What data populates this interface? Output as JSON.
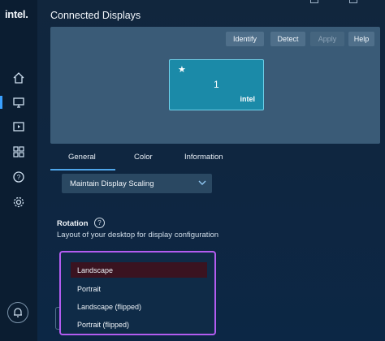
{
  "app": {
    "logo_text": "intel."
  },
  "page": {
    "title": "Connected Displays"
  },
  "sidebar": {
    "items": [
      {
        "icon": "home-icon"
      },
      {
        "icon": "display-icon",
        "active": true
      },
      {
        "icon": "video-icon"
      },
      {
        "icon": "apps-grid-icon"
      },
      {
        "icon": "help-icon"
      },
      {
        "icon": "settings-gear-icon"
      }
    ],
    "bottom_icon": "notification-bell-icon"
  },
  "toolbar": {
    "identify": "Identify",
    "detect": "Detect",
    "apply": "Apply",
    "help": "Help"
  },
  "display": {
    "number": "1",
    "brand": "intel",
    "primary_marker": "★"
  },
  "tabs": [
    {
      "label": "General",
      "active": true
    },
    {
      "label": "Color",
      "active": false
    },
    {
      "label": "Information",
      "active": false
    }
  ],
  "scaling": {
    "value": "Maintain Display Scaling"
  },
  "rotation": {
    "title": "Rotation",
    "help_glyph": "?",
    "description": "Layout of your desktop for display configuration",
    "options": [
      {
        "label": "Landscape",
        "selected": true
      },
      {
        "label": "Portrait",
        "selected": false
      },
      {
        "label": "Landscape (flipped)",
        "selected": false
      },
      {
        "label": "Portrait (flipped)",
        "selected": false
      }
    ]
  },
  "colors": {
    "accent": "#4fa6ea",
    "highlight_frame": "#b35cf0",
    "monitor_fill": "#1b8aa8",
    "selected_option": "#3a1320"
  }
}
